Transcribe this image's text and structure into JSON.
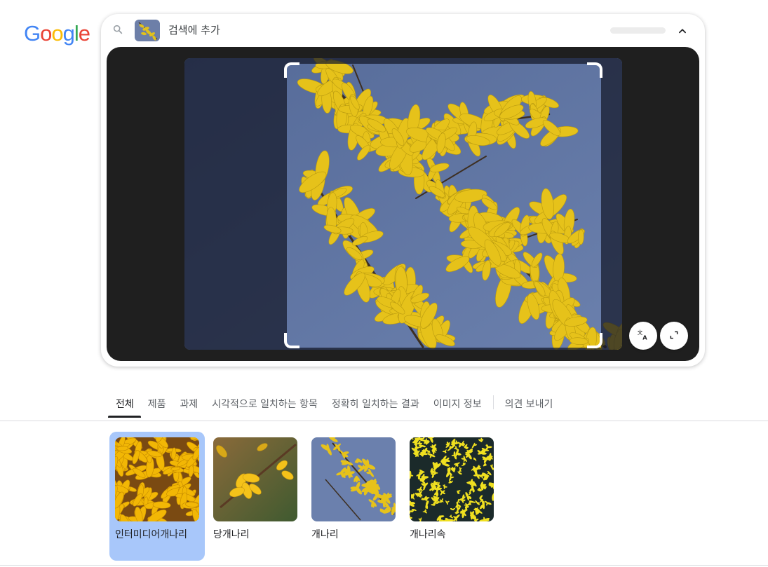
{
  "header": {
    "logo_letters": [
      "G",
      "o",
      "o",
      "g",
      "l",
      "e"
    ],
    "logo_colors": [
      "#4285F4",
      "#EA4335",
      "#FBBC05",
      "#4285F4",
      "#34A853",
      "#EA4335"
    ]
  },
  "search": {
    "add_to_search_label": "검색에 추가",
    "icon": "search-icon",
    "collapse_icon": "chevron-up-icon"
  },
  "viewer": {
    "translate_icon": "translate-icon",
    "expand_icon": "expand-icon"
  },
  "tabs": [
    {
      "label": "전체",
      "active": true
    },
    {
      "label": "제품",
      "active": false
    },
    {
      "label": "과제",
      "active": false
    },
    {
      "label": "시각적으로 일치하는 항목",
      "active": false
    },
    {
      "label": "정확히 일치하는 결과",
      "active": false
    },
    {
      "label": "이미지 정보",
      "active": false
    },
    {
      "label": "의견 보내기",
      "active": false
    }
  ],
  "results": [
    {
      "label": "인터미디어개나리",
      "selected": true
    },
    {
      "label": "당개나리",
      "selected": false
    },
    {
      "label": "개나리",
      "selected": false
    },
    {
      "label": "개나리속",
      "selected": false
    }
  ],
  "colors": {
    "selected_card": "#a8c7fa",
    "viewer_bg": "#1f1f1f",
    "sky": "#5b6f9a",
    "flower": "#e6c21a"
  }
}
